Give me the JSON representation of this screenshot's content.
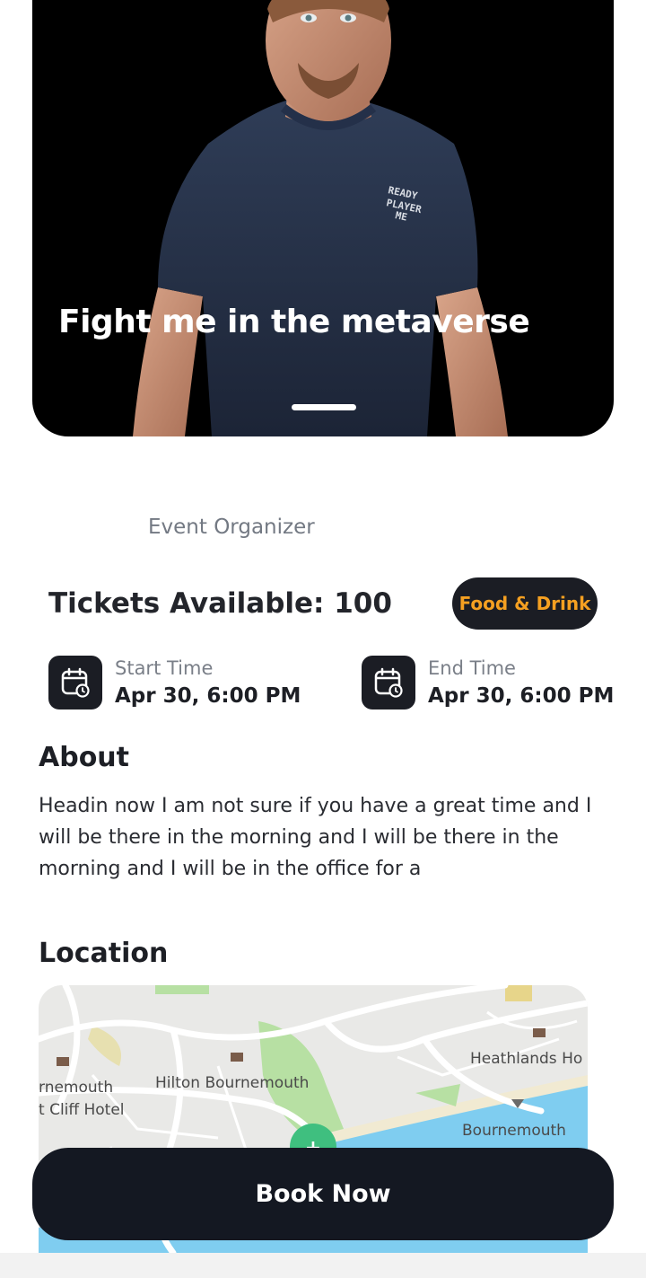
{
  "hero": {
    "title": "Fight me in the metaverse",
    "shirt_logo": "READY PLAYER ME"
  },
  "event": {
    "organizer_label": "Event Organizer",
    "tickets_text": "Tickets Available: 100",
    "category_badge": "Food & Drink",
    "start": {
      "label": "Start Time",
      "value": "Apr 30, 6:00 PM",
      "icon": "calendar-clock-icon"
    },
    "end": {
      "label": "End Time",
      "value": "Apr 30, 6:00 PM",
      "icon": "calendar-clock-icon"
    }
  },
  "about": {
    "heading": "About",
    "text": "Headin now I am not sure if you have a great time and I will be there in the morning and I will be there in the morning and I will be in the office for a"
  },
  "location": {
    "heading": "Location",
    "map_labels": {
      "heathlands": "Heathlands Ho",
      "hilton": "Hilton Bournemouth",
      "rnemouth": "rnemouth",
      "cliff_hotel": "t Cliff Hotel",
      "bournemouth": "Bournemouth"
    }
  },
  "actions": {
    "book_label": "Book Now"
  },
  "colors": {
    "accent": "#f5a021",
    "dark": "#141822",
    "water": "#7fcdf0",
    "park": "#b7e0a3"
  }
}
